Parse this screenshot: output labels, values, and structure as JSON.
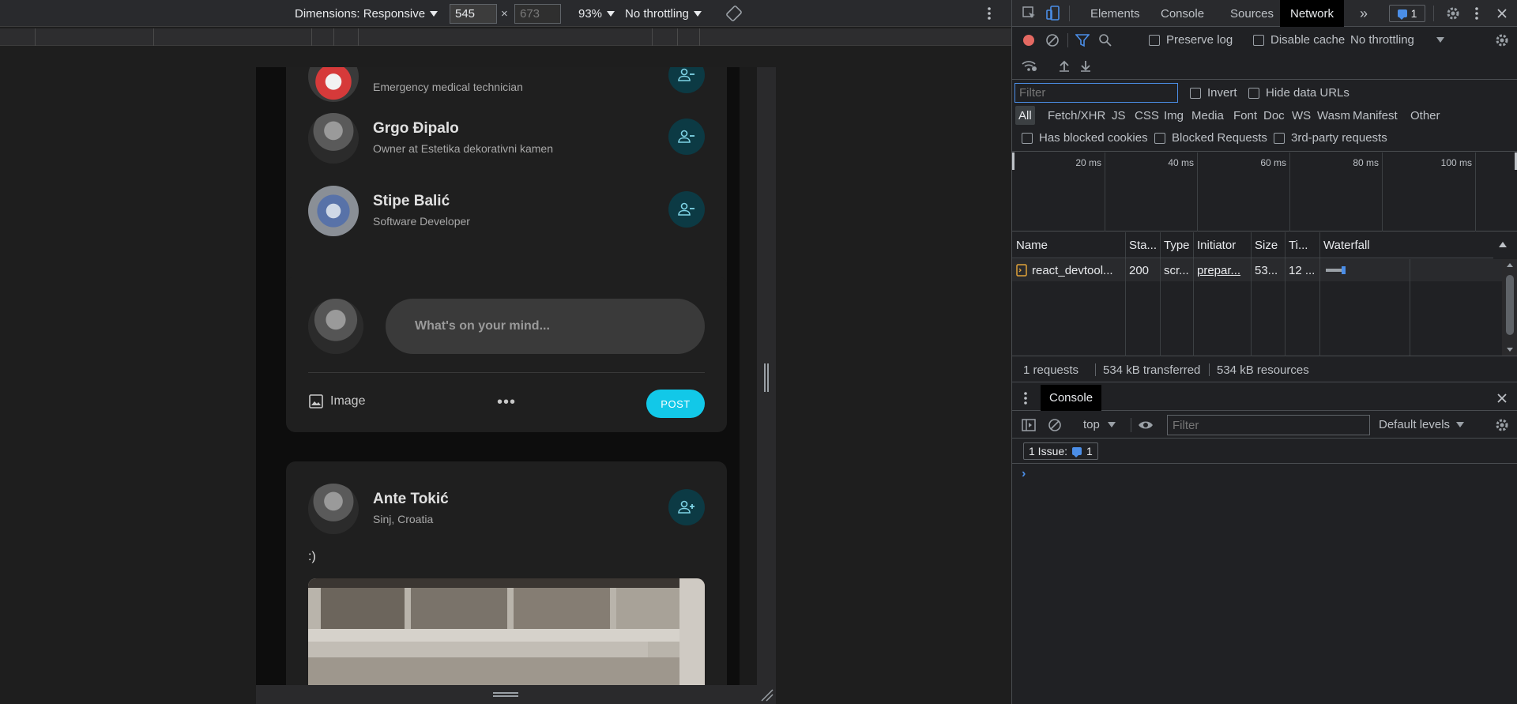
{
  "toolbar": {
    "dimensions_label": "Dimensions: Responsive",
    "width_value": "545",
    "height_value": "673",
    "times": "×",
    "zoom": "93%",
    "throttling": "No throttling"
  },
  "page": {
    "friends": [
      {
        "name": "",
        "subtitle": "Emergency medical technician"
      },
      {
        "name": "Grgo Đipalo",
        "subtitle": "Owner at Estetika dekorativni kamen"
      },
      {
        "name": "Stipe Balić",
        "subtitle": "Software Developer"
      }
    ],
    "composer": {
      "placeholder": "What's on your mind...",
      "image_label": "Image",
      "more_label": "•••",
      "post_label": "POST"
    },
    "post": {
      "author": "Ante Tokić",
      "location": "Sinj, Croatia",
      "text": ":)"
    }
  },
  "devtools": {
    "tabs": [
      "Elements",
      "Console",
      "Sources",
      "Network"
    ],
    "active_tab": "Network",
    "more_tabs": "»",
    "issue_count": "1",
    "network": {
      "preserve_log": "Preserve log",
      "disable_cache": "Disable cache",
      "throttling": "No throttling",
      "filter_placeholder": "Filter",
      "invert": "Invert",
      "hide_data_urls": "Hide data URLs",
      "types": [
        "All",
        "Fetch/XHR",
        "JS",
        "CSS",
        "Img",
        "Media",
        "Font",
        "Doc",
        "WS",
        "Wasm",
        "Manifest",
        "Other"
      ],
      "active_type": "All",
      "has_blocked_cookies": "Has blocked cookies",
      "blocked_requests": "Blocked Requests",
      "third_party": "3rd-party requests",
      "timeline_labels": [
        "20 ms",
        "40 ms",
        "60 ms",
        "80 ms",
        "100 ms"
      ],
      "columns": [
        "Name",
        "Sta...",
        "Type",
        "Initiator",
        "Size",
        "Ti...",
        "Waterfall"
      ],
      "rows": [
        {
          "name": "react_devtool...",
          "status": "200",
          "type": "scr...",
          "initiator": "prepar...",
          "size": "53...",
          "time": "12 ...",
          "waterfall_fraction": 0.2
        }
      ],
      "summary": {
        "requests": "1 requests",
        "transferred": "534 kB transferred",
        "resources": "534 kB resources"
      }
    },
    "drawer": {
      "tab": "Console",
      "context": "top",
      "filter_placeholder": "Filter",
      "levels": "Default levels",
      "issues_label": "1 Issue:",
      "issues_count": "1",
      "prompt": "›"
    }
  }
}
